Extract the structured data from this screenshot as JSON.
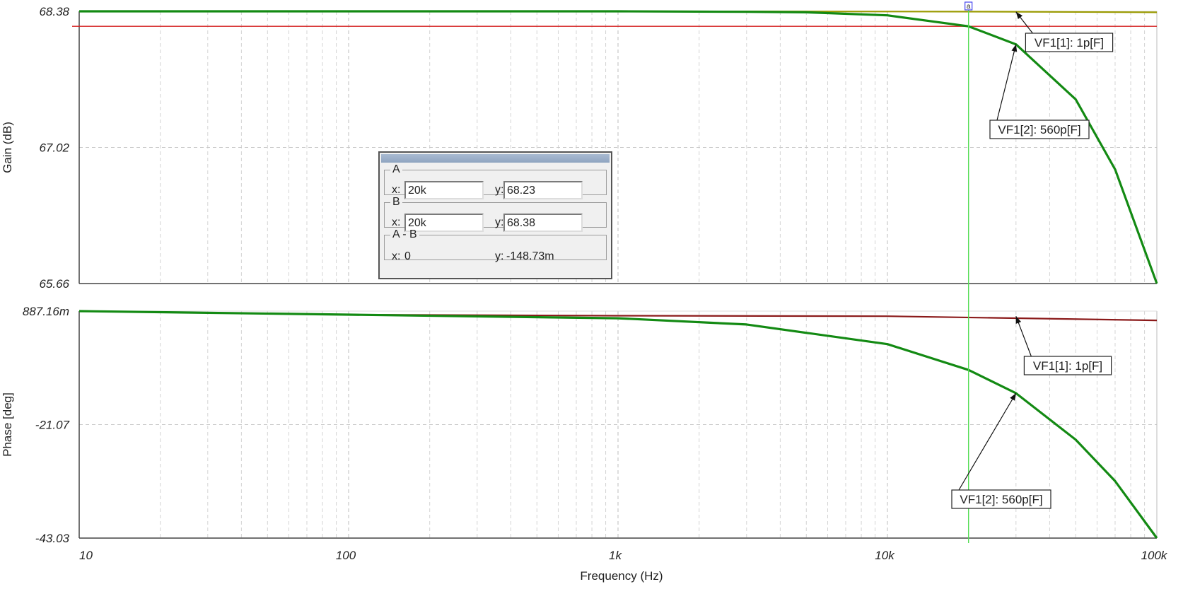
{
  "chart_data": [
    {
      "type": "line",
      "name": "gain-panel",
      "ylabel": "Gain (dB)",
      "xscale": "log",
      "xlim": [
        10,
        100000
      ],
      "ylim": [
        65.66,
        68.38
      ],
      "yticks": [
        "68.38",
        "67.02",
        "65.66"
      ],
      "series": [
        {
          "color": "#9a9a00",
          "points": [
            [
              10,
              68.38
            ],
            [
              1000,
              68.38
            ],
            [
              3000,
              68.379
            ],
            [
              10000,
              68.378
            ],
            [
              30000,
              68.376
            ],
            [
              100000,
              68.37
            ]
          ]
        },
        {
          "color": "#138a13",
          "points": [
            [
              10,
              68.38
            ],
            [
              1000,
              68.38
            ],
            [
              3000,
              68.375
            ],
            [
              5000,
              68.37
            ],
            [
              10000,
              68.34
            ],
            [
              20000,
              68.23
            ],
            [
              30000,
              68.05
            ],
            [
              50000,
              67.5
            ],
            [
              70000,
              66.8
            ],
            [
              100000,
              65.66
            ]
          ]
        }
      ],
      "reference_line": {
        "y": 68.23,
        "color": "#d42020"
      },
      "annotations": [
        {
          "text": "VF1[1]: 1p[F]",
          "x": 30000,
          "y": 68.375
        },
        {
          "text": "VF1[2]: 560p[F]",
          "x": 30000,
          "y": 68.05
        }
      ]
    },
    {
      "type": "line",
      "name": "phase-panel",
      "ylabel": "Phase [deg]",
      "xlabel": "Frequency (Hz)",
      "xscale": "log",
      "xlim": [
        10,
        100000
      ],
      "ylim": [
        -43.03,
        0.88716
      ],
      "yticks": [
        "887.16m",
        "-21.07",
        "-43.03"
      ],
      "xticks": [
        "10",
        "100",
        "1k",
        "10k",
        "100k"
      ],
      "series": [
        {
          "color": "#8b1a1a",
          "points": [
            [
              10,
              0.887
            ],
            [
              100,
              0.2
            ],
            [
              1000,
              0.0
            ],
            [
              10000,
              -0.1
            ],
            [
              100000,
              -0.9
            ]
          ]
        },
        {
          "color": "#138a13",
          "points": [
            [
              10,
              0.887
            ],
            [
              100,
              0.2
            ],
            [
              1000,
              -0.5
            ],
            [
              3000,
              -1.7
            ],
            [
              10000,
              -5.5
            ],
            [
              20000,
              -10.5
            ],
            [
              30000,
              -15.0
            ],
            [
              50000,
              -24.0
            ],
            [
              70000,
              -32.0
            ],
            [
              100000,
              -43.03
            ]
          ]
        }
      ],
      "annotations": [
        {
          "text": "VF1[1]: 1p[F]",
          "x": 30000,
          "y": -0.1
        },
        {
          "text": "VF1[2]: 560p[F]",
          "x": 30000,
          "y": -15.0
        }
      ]
    }
  ],
  "cursor": {
    "x": 20000,
    "line_color": "#55dd55",
    "marker_label": "a"
  },
  "cursor_panel": {
    "a": {
      "legend": "A",
      "x_label": "x:",
      "x_value": "20k",
      "y_label": "y:",
      "y_value": "68.23"
    },
    "b": {
      "legend": "B",
      "x_label": "x:",
      "x_value": "20k",
      "y_label": "y:",
      "y_value": "68.38"
    },
    "diff": {
      "legend": "A - B",
      "x_label": "x:",
      "x_value": "0",
      "y_label": "y:",
      "y_value": "-148.73m"
    }
  }
}
